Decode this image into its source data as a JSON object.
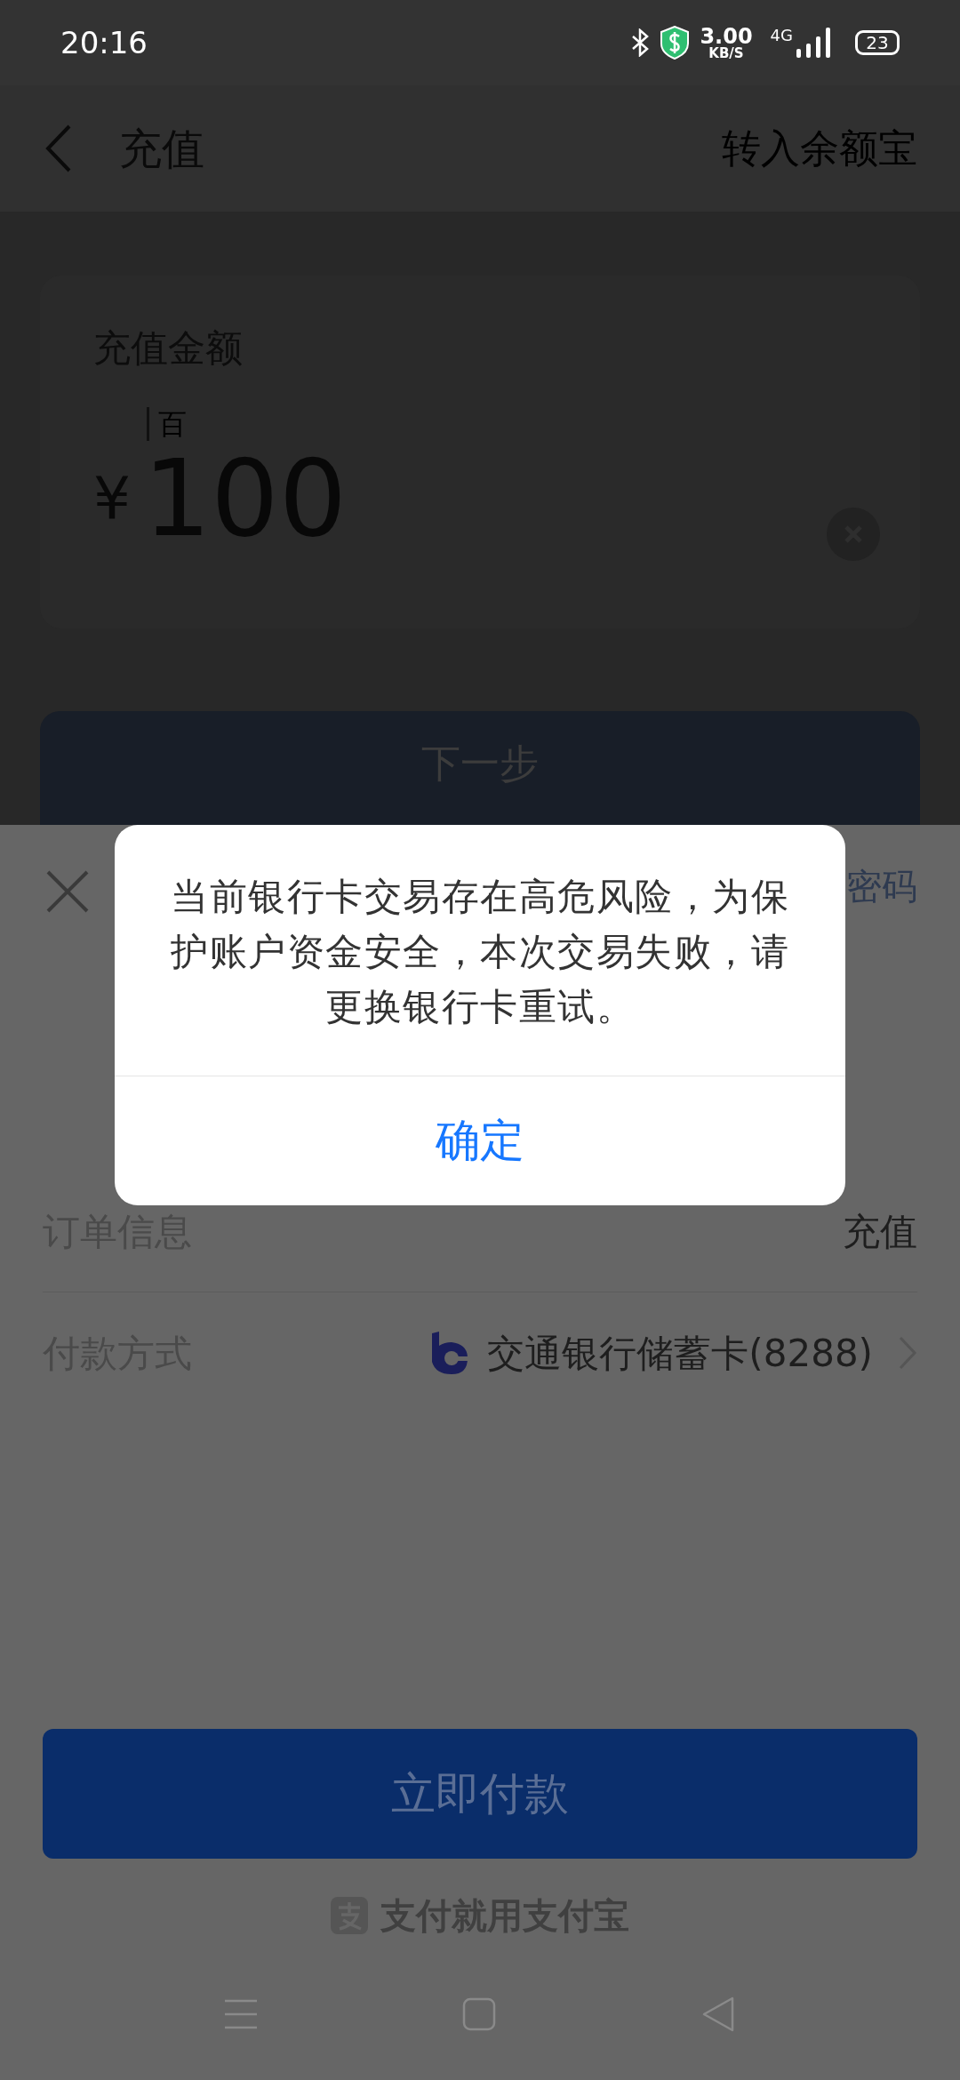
{
  "status_bar": {
    "time": "20:16",
    "speed_value": "3.00",
    "speed_unit": "KB/S",
    "network": "4G",
    "battery": "23"
  },
  "header": {
    "title": "充值",
    "action": "转入余额宝"
  },
  "amount_card": {
    "label": "充值金额",
    "unit_hint": "百",
    "currency": "¥",
    "amount": "100"
  },
  "next_button": {
    "label": "下一步",
    "disabled": true
  },
  "payment_sheet": {
    "top_right_link": "密码",
    "rows": [
      {
        "label": "订单信息",
        "value": "充值",
        "kind": "text"
      },
      {
        "label": "付款方式",
        "value": "交通银行储蓄卡(8288)",
        "kind": "bank"
      }
    ],
    "pay_button": "立即付款",
    "footer_slogan": "支付就用支付宝"
  },
  "dialog": {
    "message": "当前银行卡交易存在高危风险，为保护账户资金安全，本次交易失败，请更换银行卡重试。",
    "confirm": "确定"
  }
}
